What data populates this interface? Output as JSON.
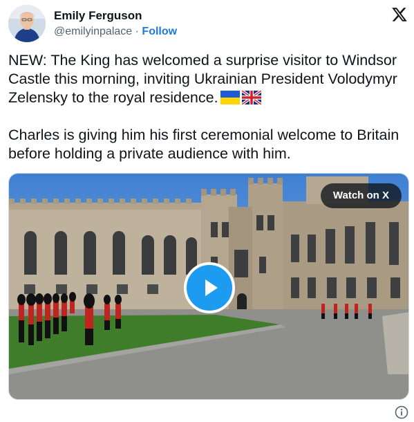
{
  "author": {
    "name": "Emily Ferguson",
    "handle": "@emilyinpalace",
    "separator": "·",
    "follow_label": "Follow"
  },
  "tweet": {
    "paragraph1": "NEW: The King has welcomed a surprise visitor to Windsor Castle this morning, inviting Ukrainian President Volodymyr Zelensky to the royal residence.",
    "paragraph2": "Charles is giving him his first ceremonial welcome to Britain before holding a private audience with him."
  },
  "media": {
    "watch_label": "Watch on X",
    "play_icon": "play-icon"
  },
  "icons": {
    "logo": "x-logo-icon",
    "info": "info-icon",
    "flags": [
      "ukraine-flag-icon",
      "uk-flag-icon"
    ]
  },
  "colors": {
    "accent": "#1d9bf0",
    "follow": "#1d7bd7",
    "text": "#0f1419",
    "secondary": "#536471"
  }
}
